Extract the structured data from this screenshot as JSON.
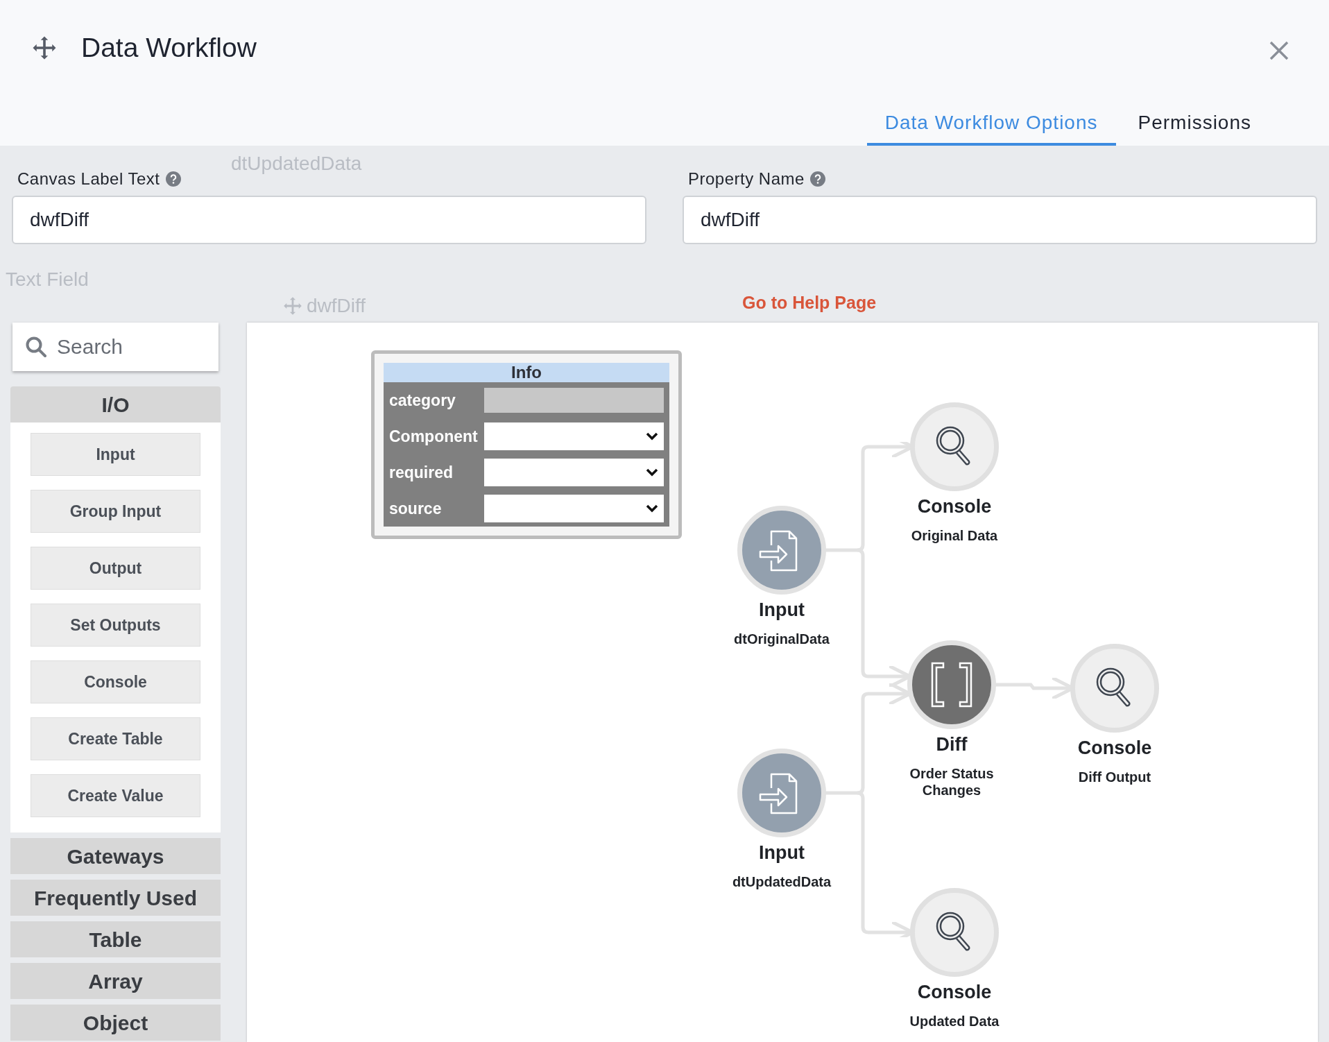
{
  "dialog": {
    "title": "Data Workflow"
  },
  "tabs": [
    {
      "label": "Data Workflow Options",
      "selected": true
    },
    {
      "label": "Permissions",
      "selected": false
    }
  ],
  "background_page": {
    "texts": [
      "dtUpdatedData",
      "Text Field",
      "dwfDiff"
    ]
  },
  "fields": [
    {
      "label": "Canvas Label Text",
      "value": "dwfDiff"
    },
    {
      "label": "Property Name",
      "value": "dwfDiff"
    }
  ],
  "help_link": "Go to Help Page",
  "palette": {
    "search": {
      "placeholder": "Search"
    },
    "sections": [
      {
        "title": "I/O",
        "expanded": true,
        "items": [
          "Input",
          "Group Input",
          "Output",
          "Set Outputs",
          "Console",
          "Create Table",
          "Create Value"
        ]
      },
      {
        "title": "Gateways",
        "expanded": false
      },
      {
        "title": "Frequently Used",
        "expanded": false
      },
      {
        "title": "Table",
        "expanded": false
      },
      {
        "title": "Array",
        "expanded": false
      },
      {
        "title": "Object",
        "expanded": false
      }
    ]
  },
  "info_panel": {
    "title": "Info",
    "rows": [
      {
        "label": "category",
        "kind": "text",
        "disabled": true
      },
      {
        "label": "Component",
        "kind": "select",
        "disabled": false
      },
      {
        "label": "required",
        "kind": "select",
        "disabled": false
      },
      {
        "label": "source",
        "kind": "select",
        "disabled": false
      }
    ]
  },
  "nodes": [
    {
      "kind": "console",
      "title": "Console",
      "subtitle": "Original Data"
    },
    {
      "kind": "input",
      "title": "Input",
      "subtitle": "dtOriginalData"
    },
    {
      "kind": "diff",
      "title": "Diff",
      "subtitle": "Order Status Changes"
    },
    {
      "kind": "console",
      "title": "Console",
      "subtitle": "Diff Output"
    },
    {
      "kind": "input",
      "title": "Input",
      "subtitle": "dtUpdatedData"
    },
    {
      "kind": "console",
      "title": "Console",
      "subtitle": "Updated Data"
    }
  ]
}
